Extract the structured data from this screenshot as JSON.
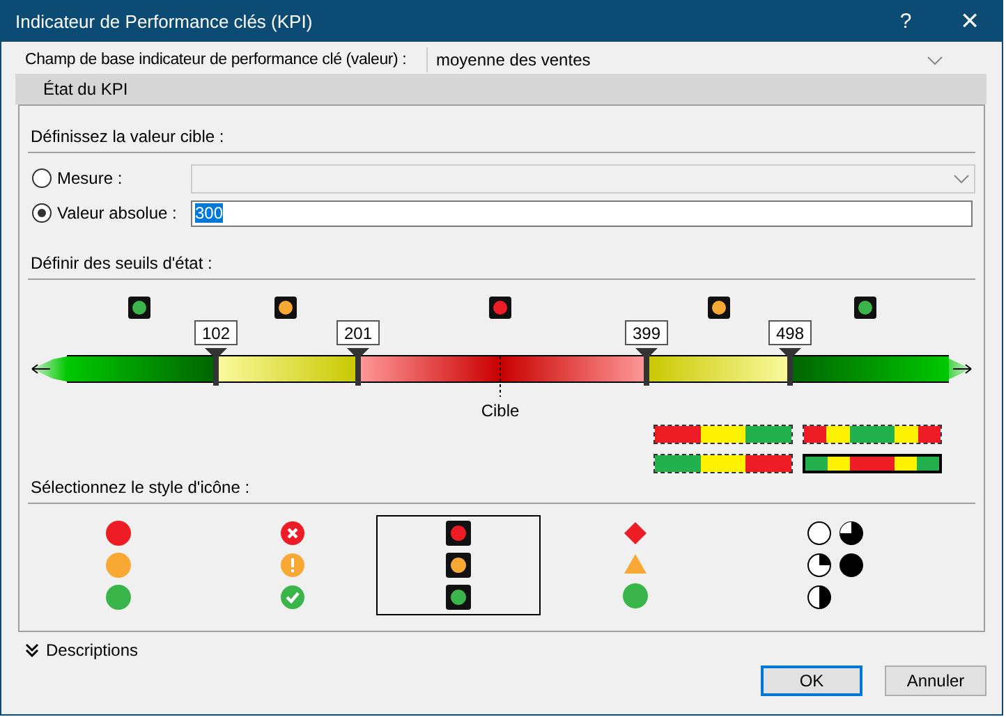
{
  "window": {
    "title": "Indicateur de Performance clés (KPI)",
    "help": "?",
    "close": "×"
  },
  "base_field": {
    "label": "Champ de base indicateur de performance clé (valeur) :",
    "value": "moyenne des ventes"
  },
  "tab": {
    "label": "État du KPI"
  },
  "target": {
    "heading": "Définissez la valeur cible :",
    "options": [
      {
        "label": "Mesure :",
        "selected": false,
        "kind": "dropdown",
        "disabled": true
      },
      {
        "label": "Valeur absolue :",
        "selected": true,
        "kind": "text",
        "value": "300"
      }
    ]
  },
  "thresholds": {
    "heading": "Définir des seuils d'état :",
    "lights": [
      {
        "color": "#3bb54a"
      },
      {
        "color": "#f7a934"
      },
      {
        "color": "#ee1c25"
      },
      {
        "color": "#f7a934"
      },
      {
        "color": "#3bb54a"
      }
    ],
    "markers": [
      "102",
      "201",
      "399",
      "498"
    ],
    "target_label": "Cible",
    "band_styles": [
      {
        "selected": false,
        "segments": [
          {
            "color": "#ee1c25"
          },
          {
            "color": "#fff200"
          },
          {
            "color": "#22b14c"
          }
        ]
      },
      {
        "selected": false,
        "segments": [
          {
            "color": "#ee1c25"
          },
          {
            "color": "#fff200"
          },
          {
            "color": "#22b14c"
          },
          {
            "color": "#fff200"
          },
          {
            "color": "#ee1c25"
          }
        ]
      },
      {
        "selected": false,
        "segments": [
          {
            "color": "#22b14c"
          },
          {
            "color": "#fff200"
          },
          {
            "color": "#ee1c25"
          }
        ]
      },
      {
        "selected": true,
        "segments": [
          {
            "color": "#22b14c"
          },
          {
            "color": "#fff200"
          },
          {
            "color": "#ee1c25"
          },
          {
            "color": "#fff200"
          },
          {
            "color": "#22b14c"
          }
        ]
      }
    ]
  },
  "icon_styles": {
    "heading": "Sélectionnez le style d'icône :",
    "styles": [
      {
        "kind": "circles",
        "selected": false
      },
      {
        "kind": "symbols",
        "selected": false
      },
      {
        "kind": "traffic",
        "selected": true
      },
      {
        "kind": "shapes",
        "selected": false
      },
      {
        "kind": "pies",
        "selected": false
      }
    ]
  },
  "descriptions": {
    "label": "Descriptions",
    "expanded": false
  },
  "buttons": [
    {
      "label": "OK",
      "default": true
    },
    {
      "label": "Annuler",
      "default": false
    }
  ]
}
